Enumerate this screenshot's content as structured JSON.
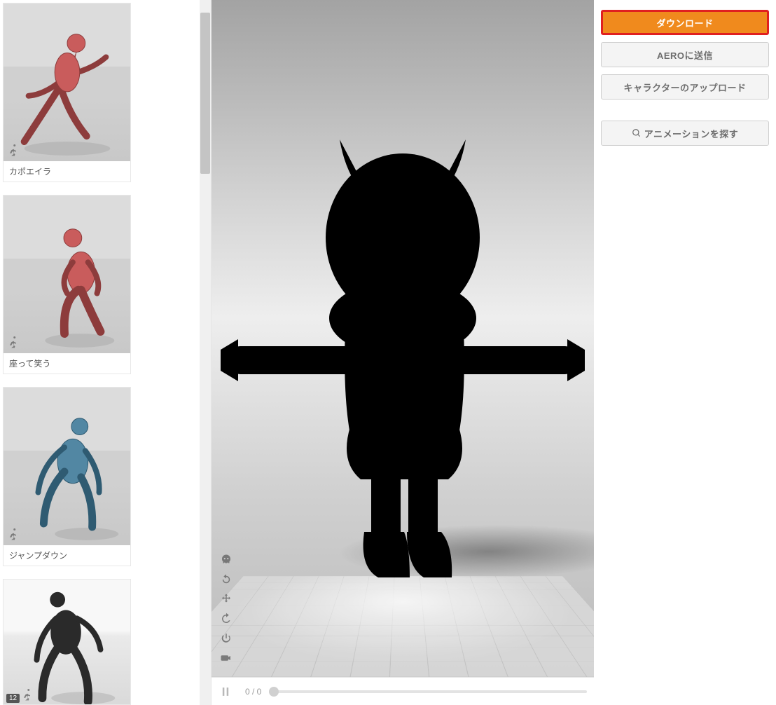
{
  "animations": [
    {
      "label": "カポエイラ",
      "figure": "pose-red-kick",
      "color": "#C95C5C",
      "bg": "bg-gray"
    },
    {
      "label": "座って笑う",
      "figure": "pose-red-sit",
      "color": "#C95C5C",
      "bg": "bg-gray"
    },
    {
      "label": "ジャンプダウン",
      "figure": "pose-blue-land",
      "color": "#5287A3",
      "bg": "bg-gray"
    },
    {
      "label": "",
      "figure": "pose-human-run",
      "color": "#2a2a2a",
      "bg": "bg-white",
      "badge": "12"
    }
  ],
  "viewport": {
    "tools": [
      {
        "name": "skull-icon"
      },
      {
        "name": "reset-icon"
      },
      {
        "name": "move-icon"
      },
      {
        "name": "rotate-icon"
      },
      {
        "name": "power-icon"
      },
      {
        "name": "camera-icon"
      }
    ]
  },
  "playback": {
    "frame_text": "0 / 0"
  },
  "right": {
    "download": "ダウンロード",
    "send_aero": "AEROに送信",
    "upload": "キャラクターのアップロード",
    "find": "アニメーションを探す"
  }
}
